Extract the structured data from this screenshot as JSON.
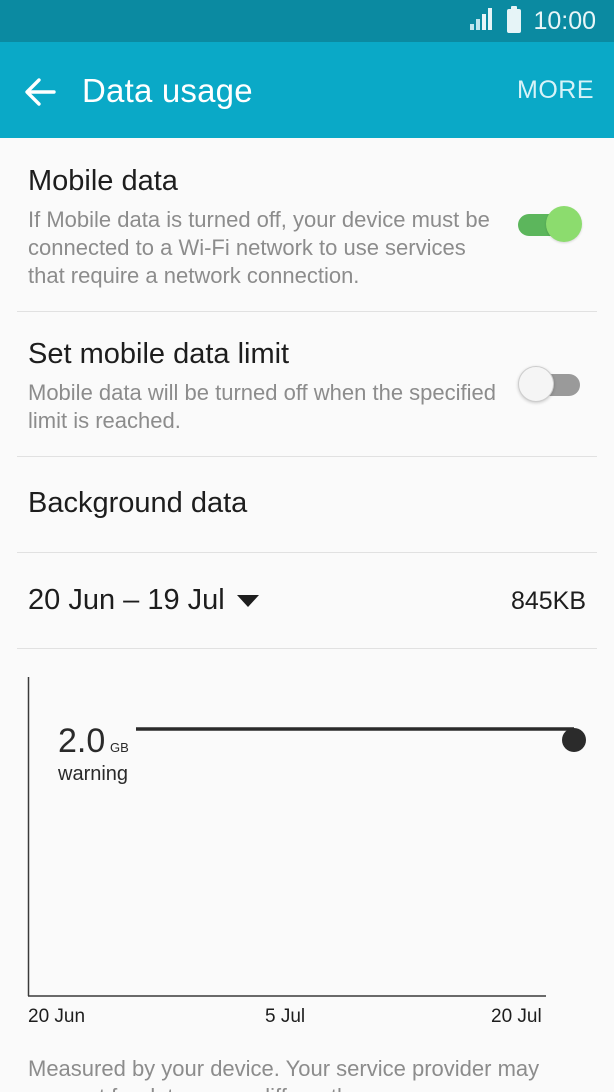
{
  "status_bar": {
    "time": "10:00",
    "signal_icon": "signal-icon",
    "battery_icon": "battery-icon"
  },
  "app_bar": {
    "back_icon": "arrow-left-icon",
    "title": "Data usage",
    "more_label": "MORE"
  },
  "mobile_data": {
    "title": "Mobile data",
    "description": "If Mobile data is turned off, your device must be connected to a Wi-Fi network to use services that require a network connection.",
    "enabled": true
  },
  "data_limit": {
    "title": "Set mobile data limit",
    "description": "Mobile data will be turned off when the specified limit is reached.",
    "enabled": false
  },
  "background_data": {
    "title": "Background data"
  },
  "cycle": {
    "range": "20 Jun – 19 Jul",
    "dropdown_icon": "dropdown-triangle-icon",
    "total": "845KB"
  },
  "chart_data": {
    "type": "line",
    "warning": {
      "value": "2.0",
      "unit": "GB",
      "label": "warning"
    },
    "x_tick_labels": [
      "20 Jun",
      "5 Jul",
      "20 Jul"
    ]
  },
  "footnote": "Measured by your device. Your service provider may account for data usage differently."
}
